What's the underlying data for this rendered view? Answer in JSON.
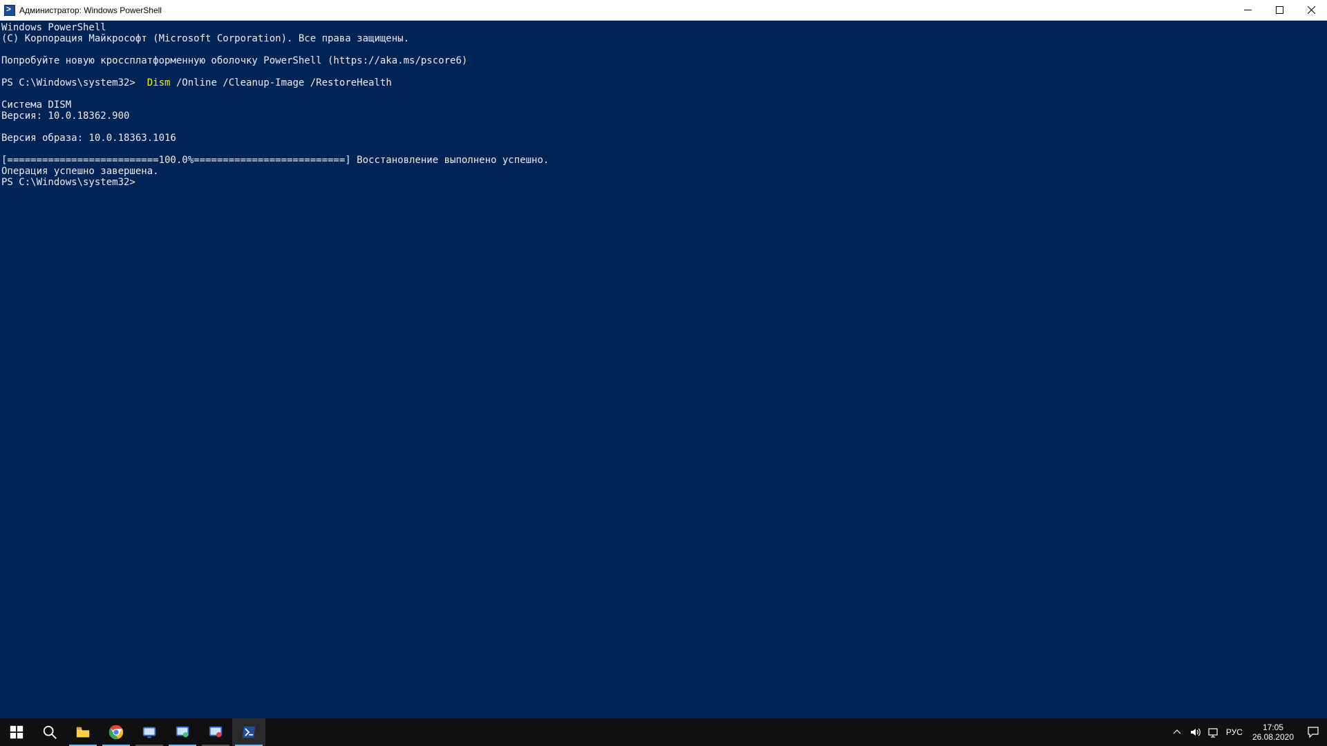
{
  "window": {
    "title": "Администратор: Windows PowerShell"
  },
  "terminal": {
    "line1": "Windows PowerShell",
    "line2": "(C) Корпорация Майкрософт (Microsoft Corporation). Все права защищены.",
    "line3": "",
    "line4": "Попробуйте новую кроссплатформенную оболочку PowerShell (https://aka.ms/pscore6)",
    "line5": "",
    "prompt1_path": "PS C:\\Windows\\system32> ",
    "cmd_dism": " Dism",
    "cmd_args": " /Online /Cleanup-Image /RestoreHealth",
    "line7": "",
    "line8": "Система DISM",
    "line9": "Версия: 10.0.18362.900",
    "line10": "",
    "line11": "Версия образа: 10.0.18363.1016",
    "line12": "",
    "line13": "[==========================100.0%==========================] Восстановление выполнено успешно.",
    "line14": "Операция успешно завершена.",
    "prompt2": "PS C:\\Windows\\system32>"
  },
  "taskbar": {
    "lang": "РУС",
    "time": "17:05",
    "date": "26.08.2020"
  }
}
